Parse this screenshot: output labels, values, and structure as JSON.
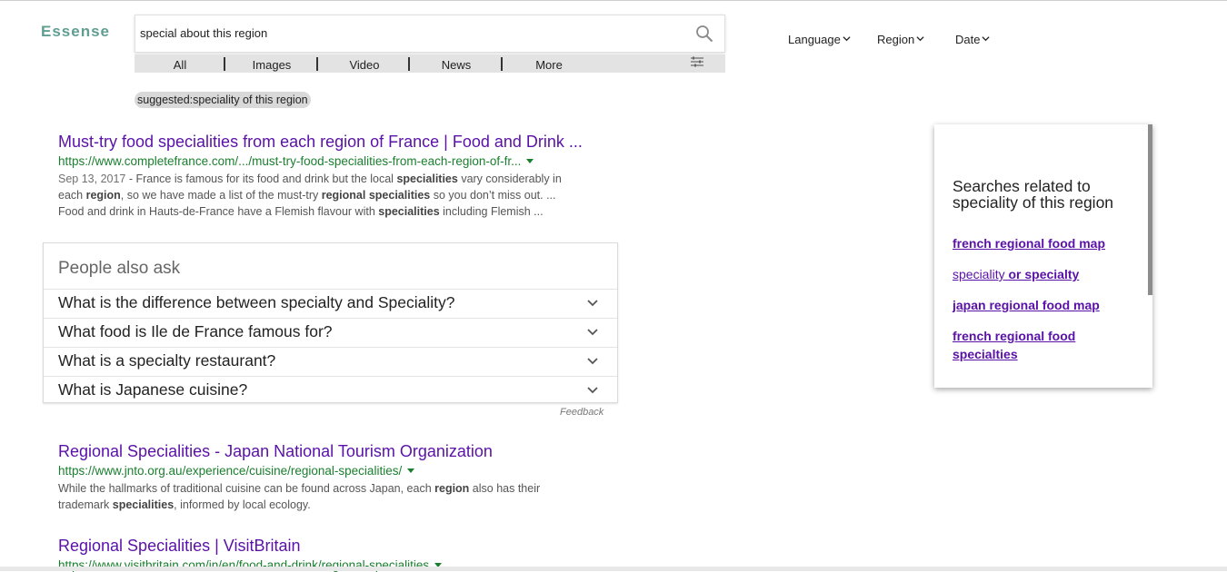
{
  "logo": "Essense",
  "search": {
    "value": "special about this region",
    "placeholder": ""
  },
  "tabs": [
    {
      "label": "All"
    },
    {
      "label": "Images"
    },
    {
      "label": "Video"
    },
    {
      "label": "News"
    },
    {
      "label": "More"
    }
  ],
  "filters": [
    {
      "label": "Language"
    },
    {
      "label": "Region"
    },
    {
      "label": "Date"
    }
  ],
  "suggested": "suggested:speciality of this region",
  "results": [
    {
      "title": "Must-try food specialities from each region of France | Food and Drink ...",
      "url": "https://www.completefrance.com/.../must-try-food-specialities-from-each-region-of-fr...",
      "date": "Sep 13, 2017",
      "snippet_lines": [
        [
          " - France is famous for its food and drink but the local ",
          "specialities",
          " vary considerably in"
        ],
        [
          "each ",
          "region",
          ", so we have made a list of the must-try ",
          "regional specialities",
          " so you don’t miss out. ..."
        ],
        [
          "Food and drink in Hauts-de-France have a Flemish flavour with ",
          "specialities",
          " including Flemish ..."
        ]
      ]
    },
    {
      "title": "Regional Specialities - Japan National Tourism Organization",
      "url": "https://www.jnto.org.au/experience/cuisine/regional-specialities/",
      "snippet_lines": [
        [
          "While the hallmarks of traditional cuisine can be found across Japan, each ",
          "region",
          " also has their"
        ],
        [
          "trademark ",
          "specialities",
          ", informed by local ecology."
        ]
      ]
    },
    {
      "title": "Regional Specialities | VisitBritain",
      "url": "https://www.visitbritain.com/in/en/food-and-drink/regional-specialities"
    }
  ],
  "people_also_ask": {
    "title": "People also ask",
    "questions": [
      "What is the difference between specialty and Speciality?",
      "What food is Ile de France famous for?",
      "What is a specialty restaurant?",
      "What is Japanese cuisine?"
    ],
    "feedback": "Feedback"
  },
  "related": {
    "title": "Searches related to speciality of this region",
    "links": [
      {
        "text": "french regional food map"
      },
      {
        "light": "speciality",
        "bold": " or specialty"
      },
      {
        "text": "japan regional food map"
      },
      {
        "text": "french regional food specialties"
      }
    ]
  },
  "colors": {
    "logo": "#5f9e91",
    "result_title": "#5a11a8",
    "result_url": "#1a7f2e",
    "tabs_bar": "#e3e3e3"
  }
}
